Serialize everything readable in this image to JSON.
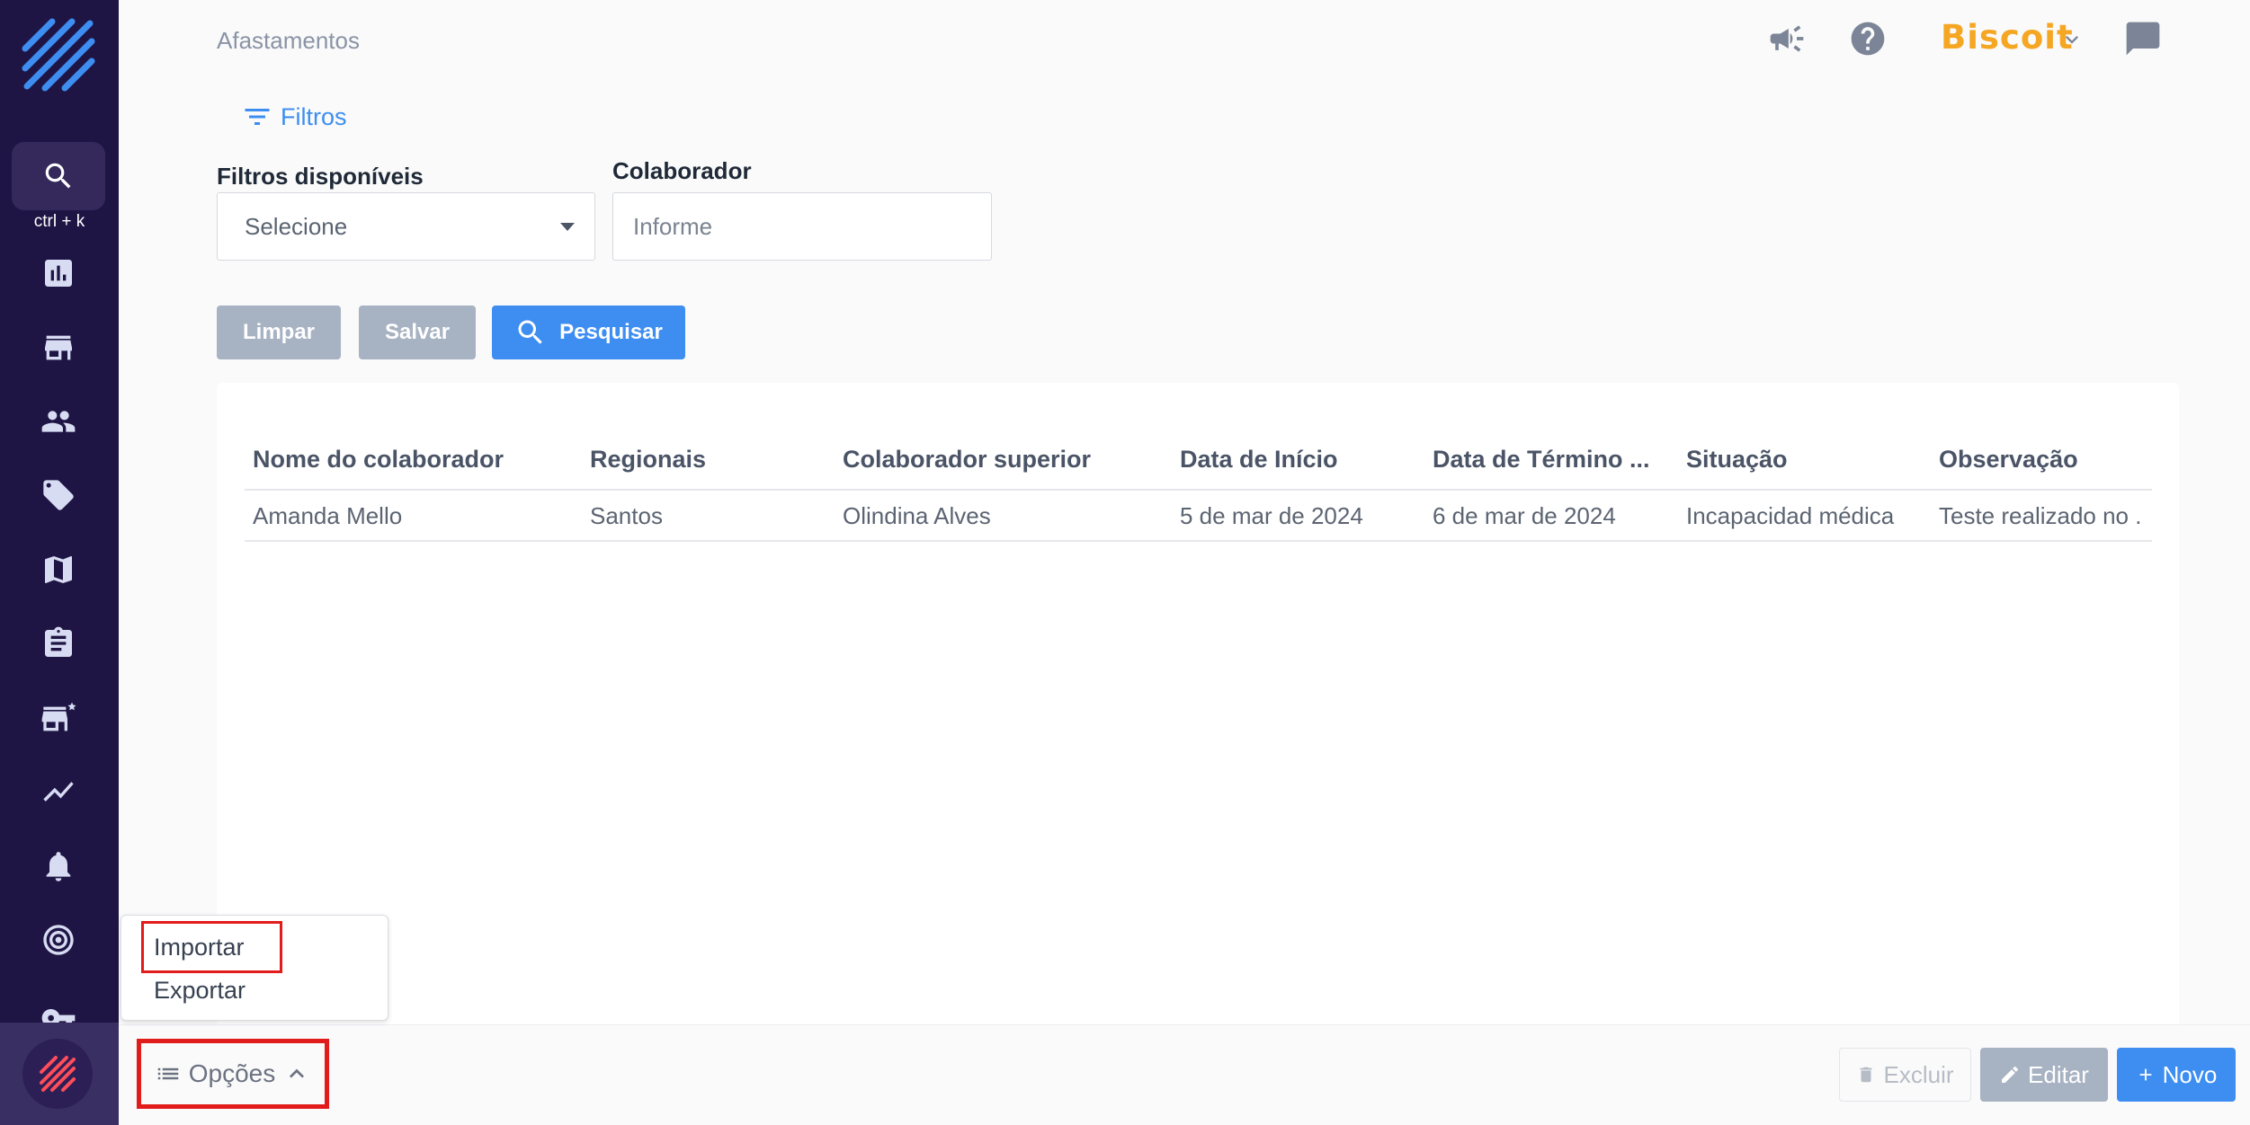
{
  "header": {
    "page_title": "Afastamentos",
    "brand": "Biscoit",
    "icons": [
      "megaphone-icon",
      "help-icon",
      "chevron-down-icon",
      "chat-icon"
    ]
  },
  "sidebar": {
    "search_shortcut": "ctrl + k",
    "items": [
      "dashboard-icon",
      "store-icon",
      "people-icon",
      "tag-icon",
      "map-icon",
      "clipboard-icon",
      "store-star-icon",
      "trend-icon",
      "bell-icon",
      "target-icon",
      "key-icon"
    ]
  },
  "filters": {
    "toggle_label": "Filtros",
    "available_label": "Filtros disponíveis",
    "available_value": "Selecione",
    "collaborator_label": "Colaborador",
    "collaborator_placeholder": "Informe"
  },
  "actions": {
    "clear": "Limpar",
    "save": "Salvar",
    "search": "Pesquisar"
  },
  "table": {
    "columns": [
      "Nome do colaborador",
      "Regionais",
      "Colaborador superior",
      "Data de Início",
      "Data de Término ...",
      "Situação",
      "Observação"
    ],
    "rows": [
      [
        "Amanda Mello",
        "Santos",
        "Olindina Alves",
        "5 de mar de 2024",
        "6 de mar de 2024",
        "Incapacidad médica",
        "Teste realizado no ."
      ]
    ]
  },
  "footer": {
    "options_label": "Opções",
    "menu_items": [
      "Importar",
      "Exportar"
    ],
    "delete": "Excluir",
    "edit": "Editar",
    "new": "Novo"
  },
  "colors": {
    "sidebar_bg": "#1e1545",
    "accent_blue": "#3d8ef0",
    "button_gray": "#a7b2c2",
    "brand_orange": "#f5a623",
    "highlight_red": "#e21b1b"
  }
}
